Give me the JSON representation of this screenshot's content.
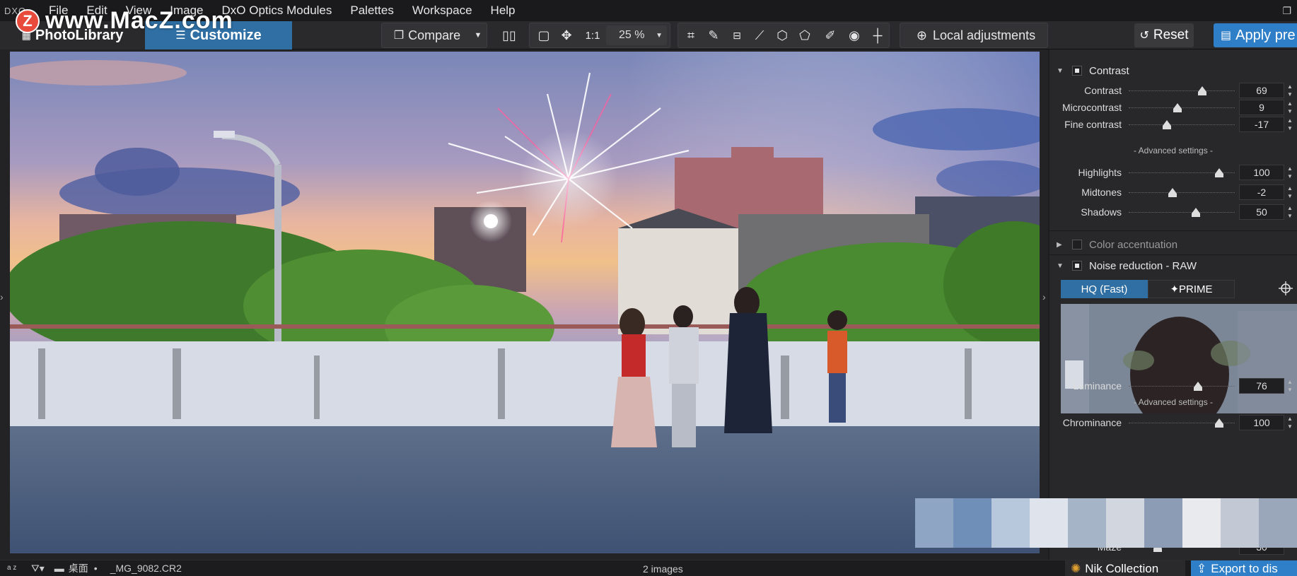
{
  "watermark": {
    "badge": "Z",
    "text": "www.MacZ.com"
  },
  "menu": {
    "logo": "DXO",
    "items": [
      "File",
      "Edit",
      "View",
      "Image",
      "DxO Optics Modules",
      "Palettes",
      "Workspace",
      "Help"
    ]
  },
  "toolbar": {
    "tab_library": "PhotoLibrary",
    "tab_customize": "Customize",
    "compare": "Compare",
    "one_to_one": "1:1",
    "zoom": "25 %",
    "local_adjustments": "Local adjustments",
    "reset": "Reset",
    "apply": "Apply pre"
  },
  "panel": {
    "contrast": {
      "title": "Contrast",
      "sliders": [
        {
          "label": "Contrast",
          "value": "69",
          "fraction": 0.69
        },
        {
          "label": "Microcontrast",
          "value": "9",
          "fraction": 0.46
        },
        {
          "label": "Fine contrast",
          "value": "-17",
          "fraction": 0.36
        }
      ],
      "advanced": "- Advanced settings -",
      "advanced_sliders": [
        {
          "label": "Highlights",
          "value": "100",
          "fraction": 0.85
        },
        {
          "label": "Midtones",
          "value": "-2",
          "fraction": 0.41
        },
        {
          "label": "Shadows",
          "value": "50",
          "fraction": 0.63
        }
      ]
    },
    "color_accentuation": {
      "title": "Color accentuation"
    },
    "noise": {
      "title": "Noise reduction - RAW",
      "mode_hq": "HQ (Fast)",
      "mode_prime": "✦PRIME",
      "luminance": {
        "label": "Luminance",
        "value": "76",
        "fraction": 0.65
      },
      "advanced": "- Advanced settings -",
      "chrominance": {
        "label": "Chrominance",
        "value": "100",
        "fraction": 0.85
      },
      "maze": {
        "label": "Maze",
        "value": "30",
        "fraction": 0.27
      }
    }
  },
  "status": {
    "sort_label": "a z",
    "folder": "桌面",
    "dot": "•",
    "filename": "_MG_9082.CR2",
    "count": "2 images",
    "nik": "Nik Collection",
    "export": "Export to dis"
  },
  "colors": {
    "accent_blue": "#2f6fa3",
    "apply_blue": "#2f7fc8"
  }
}
